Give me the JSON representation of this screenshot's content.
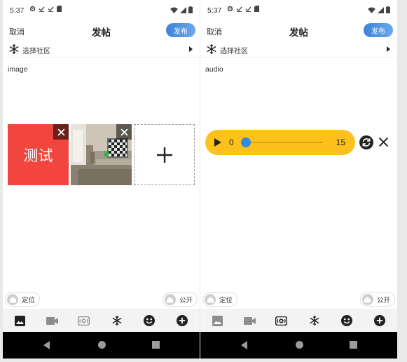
{
  "screens": [
    {
      "status": {
        "time": "5:37"
      },
      "header": {
        "cancel": "取消",
        "title": "发帖",
        "publish": "发布"
      },
      "community": {
        "label": "选择社区"
      },
      "content": {
        "text": "image"
      },
      "images": {
        "red_tile_text": "测试"
      },
      "chips": {
        "location": "定位",
        "visibility": "公开"
      },
      "toolbar": {
        "active": "image-icon"
      }
    },
    {
      "status": {
        "time": "5:37"
      },
      "header": {
        "cancel": "取消",
        "title": "发帖",
        "publish": "发布"
      },
      "community": {
        "label": "选择社区"
      },
      "content": {
        "text": "audio"
      },
      "audio": {
        "current": "0",
        "total": "15",
        "progress": 0
      },
      "chips": {
        "location": "定位",
        "visibility": "公开"
      },
      "toolbar": {
        "active": "audio-icon"
      }
    }
  ],
  "colors": {
    "accent": "#3f82d8",
    "audio_bar": "#fcc21b",
    "red_tile": "#f2453d",
    "knob": "#2e8be6"
  }
}
